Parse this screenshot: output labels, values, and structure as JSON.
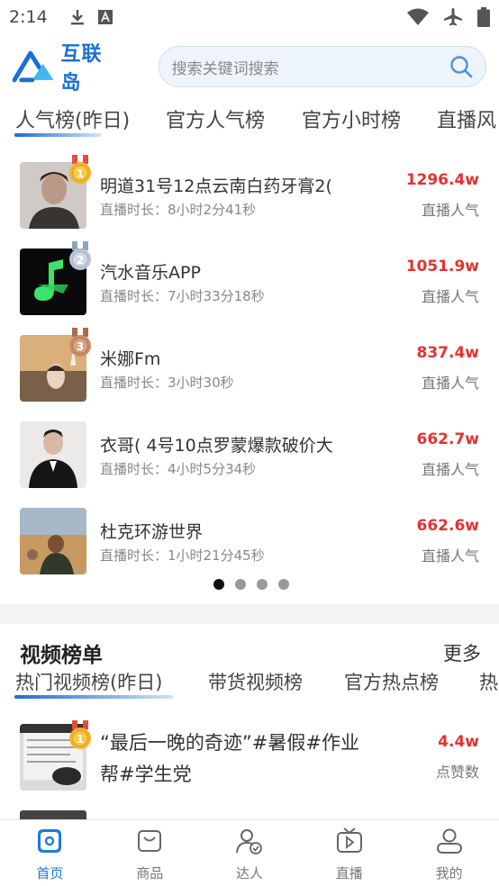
{
  "status_bar": {
    "time": "2:14",
    "icons": [
      "download-icon",
      "text-a-icon",
      "wifi-icon",
      "airplane-icon",
      "battery-icon"
    ]
  },
  "header": {
    "logo_text": "互联岛",
    "search_placeholder": "搜索关键词搜索"
  },
  "rank_tabs": [
    {
      "label": "人气榜(昨日)",
      "active": true
    },
    {
      "label": "官方人气榜",
      "active": false
    },
    {
      "label": "官方小时榜",
      "active": false
    },
    {
      "label": "直播风",
      "active": false
    }
  ],
  "rank_list": [
    {
      "rank": "1",
      "title": "明道31号12点云南白药牙膏2(",
      "duration": "直播时长：8小时2分41秒",
      "value": "1296.4w",
      "label": "直播人气"
    },
    {
      "rank": "2",
      "title": "汽水音乐APP",
      "duration": "直播时长：7小时33分18秒",
      "value": "1051.9w",
      "label": "直播人气"
    },
    {
      "rank": "3",
      "title": "米娜Fm",
      "duration": "直播时长：3小时30秒",
      "value": "837.4w",
      "label": "直播人气"
    },
    {
      "rank": "",
      "title": "衣哥( 4号10点罗蒙爆款破价大",
      "duration": "直播时长：4小时5分34秒",
      "value": "662.7w",
      "label": "直播人气"
    },
    {
      "rank": "",
      "title": "杜克环游世界",
      "duration": "直播时长：1小时21分45秒",
      "value": "662.6w",
      "label": "直播人气"
    }
  ],
  "pagination": {
    "count": 4,
    "active_index": 0
  },
  "video_section": {
    "title": "视频榜单",
    "more": "更多",
    "tabs": [
      {
        "label": "热门视频榜(昨日)",
        "active": true
      },
      {
        "label": "带货视频榜",
        "active": false
      },
      {
        "label": "官方热点榜",
        "active": false
      },
      {
        "label": "热",
        "active": false
      }
    ],
    "items": [
      {
        "rank": "1",
        "title": "“最后一晚的奇迹”#暑假#作业帮#学生党",
        "value": "4.4w",
        "label": "点赞数"
      }
    ]
  },
  "bottom_nav": [
    {
      "label": "首页",
      "icon": "home-icon",
      "active": true
    },
    {
      "label": "商品",
      "icon": "bag-icon",
      "active": false
    },
    {
      "label": "达人",
      "icon": "person-check-icon",
      "active": false
    },
    {
      "label": "直播",
      "icon": "tv-play-icon",
      "active": false
    },
    {
      "label": "我的",
      "icon": "user-icon",
      "active": false
    }
  ],
  "colors": {
    "accent": "#1a78e6",
    "value_red": "#e8302f",
    "gold": "#f2b42a",
    "silver": "#b8c6d6",
    "bronze": "#c98d66"
  }
}
